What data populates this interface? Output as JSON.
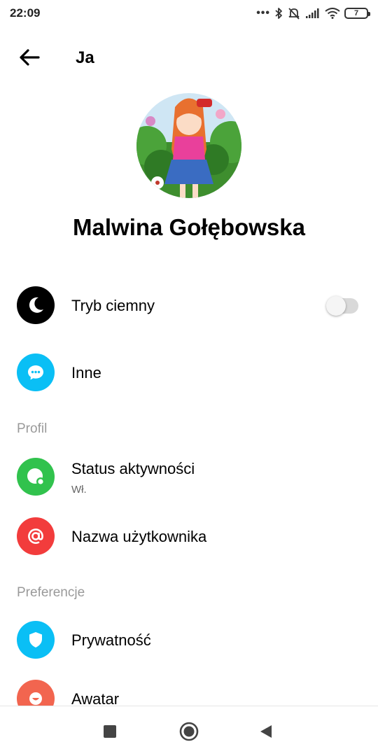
{
  "status_bar": {
    "time": "22:09",
    "dots": "•••",
    "battery": "7",
    "icons": [
      "bluetooth-icon",
      "muted-bell-icon",
      "signal-icon",
      "wifi-icon",
      "battery-icon"
    ]
  },
  "header": {
    "title": "Ja",
    "back_icon": "arrow-left-icon"
  },
  "profile": {
    "name": "Malwina Gołębowska"
  },
  "rows": {
    "dark_mode": {
      "label": "Tryb ciemny",
      "icon": "moon-icon",
      "icon_bg": "#000000",
      "toggle_on": false
    },
    "other": {
      "label": "Inne",
      "icon": "chat-bubble-icon",
      "icon_bg": "#0ABFF5"
    },
    "activity_status": {
      "label": "Status aktywności",
      "sub": "Wł.",
      "icon": "activity-status-icon",
      "icon_bg": "#31C24D"
    },
    "username": {
      "label": "Nazwa użytkownika",
      "icon": "at-sign-icon",
      "icon_bg": "#F23C3C"
    },
    "privacy": {
      "label": "Prywatność",
      "icon": "shield-icon",
      "icon_bg": "#0ABFF5"
    },
    "avatar": {
      "label": "Awatar",
      "icon": "avatar-face-icon",
      "icon_bg": "#F2654F"
    }
  },
  "sections": {
    "profile": "Profil",
    "preferences": "Preferencje"
  },
  "nav": {
    "icons": [
      "recents-square-icon",
      "home-circle-icon",
      "back-triangle-icon"
    ]
  }
}
